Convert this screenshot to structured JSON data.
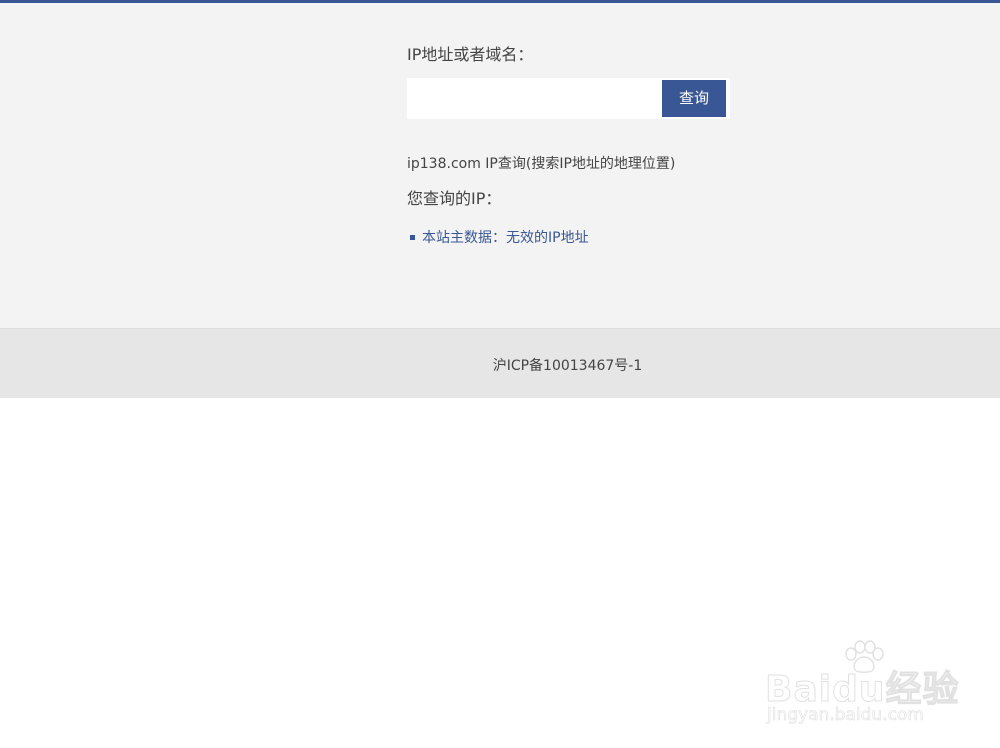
{
  "form": {
    "label": "IP地址或者域名：",
    "input_value": "",
    "input_placeholder": "",
    "button_label": "查询"
  },
  "info": {
    "site_line": "ip138.com IP查询(搜索IP地址的地理位置)",
    "your_ip_label": "您查询的IP："
  },
  "results": [
    "本站主数据：无效的IP地址"
  ],
  "footer": {
    "icp": "沪ICP备10013467号-1"
  },
  "watermark": {
    "brand": "Baidu经验",
    "url": "jingyan.baidu.com"
  },
  "colors": {
    "accent": "#3a5795",
    "main_bg": "#f3f3f3",
    "footer_bg": "#e6e6e6"
  }
}
